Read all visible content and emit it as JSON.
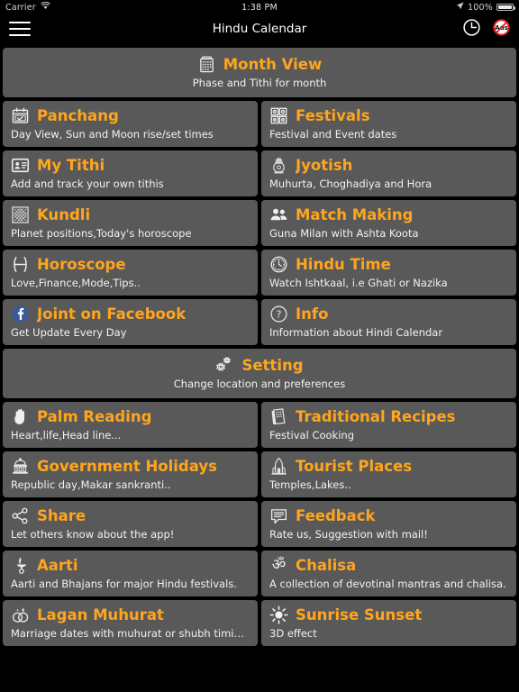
{
  "status_bar": {
    "carrier": "Carrier",
    "wifi_icon": "wifi-icon",
    "time": "1:38 PM",
    "location_icon": "location-arrow-icon",
    "battery_percent": "100%",
    "battery_icon": "battery-full-icon"
  },
  "nav_bar": {
    "menu_icon": "hamburger-menu-icon",
    "title": "Hindu Calendar",
    "clock_icon": "clock-icon",
    "ads_label": "Ads",
    "ads_icon": "no-ads-icon"
  },
  "accent_colors": {
    "title_orange": "#ffa51e",
    "card_background": "#595959",
    "page_background": "#000000",
    "subtitle_white": "#f2f2f2",
    "facebook_blue": "#3b5998",
    "ads_red": "#e01b1b"
  },
  "items": [
    {
      "id": "month-view",
      "title": "Month View",
      "subtitle": "Phase and Tithi for month",
      "icon": "calendar-month-icon",
      "full_width": true
    },
    {
      "id": "panchang",
      "title": "Panchang",
      "subtitle": "Day View, Sun and Moon rise/set times",
      "icon": "calendar-check-icon",
      "full_width": false
    },
    {
      "id": "festivals",
      "title": "Festivals",
      "subtitle": "Festival and Event dates",
      "icon": "grid-cells-icon",
      "full_width": false
    },
    {
      "id": "my-tithi",
      "title": "My Tithi",
      "subtitle": "Add and track your own tithis",
      "icon": "id-card-icon",
      "full_width": false
    },
    {
      "id": "jyotish",
      "title": "Jyotish",
      "subtitle": "Muhurta, Choghadiya and Hora",
      "icon": "kalash-pot-icon",
      "full_width": false
    },
    {
      "id": "kundli",
      "title": "Kundli",
      "subtitle": "Planet positions,Today's horoscope",
      "icon": "chart-grid-icon",
      "full_width": false
    },
    {
      "id": "match-making",
      "title": "Match Making",
      "subtitle": "Guna Milan with Ashta Koota",
      "icon": "two-people-icon",
      "full_width": false
    },
    {
      "id": "horoscope",
      "title": "Horoscope",
      "subtitle": "Love,Finance,Mode,Tips..",
      "icon": "pisces-zodiac-icon",
      "full_width": false
    },
    {
      "id": "hindu-time",
      "title": "Hindu Time",
      "subtitle": "Watch Ishtkaal, i.e Ghati or Nazika",
      "icon": "clock-face-icon",
      "full_width": false
    },
    {
      "id": "joint-on-facebook",
      "title": "Joint on Facebook",
      "subtitle": "Get Update Every Day",
      "icon": "facebook-icon",
      "full_width": false
    },
    {
      "id": "info",
      "title": "Info",
      "subtitle": "Information about Hindi Calendar",
      "icon": "question-circle-icon",
      "full_width": false
    },
    {
      "id": "setting",
      "title": "Setting",
      "subtitle": "Change location and preferences",
      "icon": "gears-icon",
      "full_width": true
    },
    {
      "id": "palm-reading",
      "title": "Palm Reading",
      "subtitle": "Heart,life,Head line...",
      "icon": "hand-palm-icon",
      "full_width": false
    },
    {
      "id": "traditional-recipes",
      "title": "Traditional Recipes",
      "subtitle": "Festival Cooking",
      "icon": "recipe-book-icon",
      "full_width": false
    },
    {
      "id": "government-holidays",
      "title": "Government Holidays",
      "subtitle": "Republic day,Makar sankranti..",
      "icon": "government-building-icon",
      "full_width": false
    },
    {
      "id": "tourist-places",
      "title": "Tourist Places",
      "subtitle": "Temples,Lakes..",
      "icon": "temple-monument-icon",
      "full_width": false
    },
    {
      "id": "share",
      "title": "Share",
      "subtitle": "Let others know about the app!",
      "icon": "share-nodes-icon",
      "full_width": false
    },
    {
      "id": "feedback",
      "title": "Feedback",
      "subtitle": "Rate us, Suggestion with mail!",
      "icon": "comment-lines-icon",
      "full_width": false
    },
    {
      "id": "aarti",
      "title": "Aarti",
      "subtitle": "Aarti and Bhajans for major Hindu festivals.",
      "icon": "diya-lamp-icon",
      "full_width": false
    },
    {
      "id": "chalisa",
      "title": "Chalisa",
      "subtitle": "A collection of devotinal mantras and chalisa.",
      "icon": "om-symbol-icon",
      "full_width": false
    },
    {
      "id": "lagan-muhurat",
      "title": "Lagan Muhurat",
      "subtitle": "Marriage dates with muhurat or shubh timings",
      "icon": "wedding-rings-icon",
      "full_width": false
    },
    {
      "id": "sunrise-sunset",
      "title": "Sunrise Sunset",
      "subtitle": "3D effect",
      "icon": "sun-icon",
      "full_width": false
    }
  ]
}
